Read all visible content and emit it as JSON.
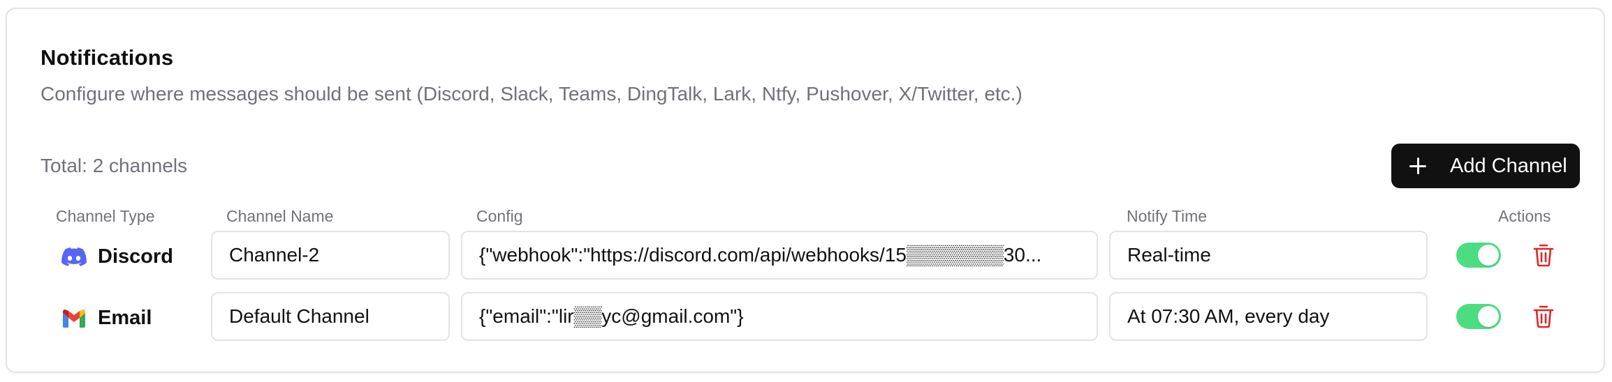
{
  "section": {
    "title": "Notifications",
    "description": "Configure where messages should be sent (Discord, Slack, Teams, DingTalk, Lark, Ntfy, Pushover, X/Twitter, etc.)",
    "total_label": "Total: 2 channels",
    "add_button_label": "Add Channel"
  },
  "table": {
    "headers": {
      "type": "Channel Type",
      "name": "Channel Name",
      "config": "Config",
      "notify_time": "Notify Time",
      "actions": "Actions"
    },
    "rows": [
      {
        "type": "Discord",
        "type_icon": "discord-icon",
        "name": "Channel-2",
        "config": "{\"webhook\":\"https://discord.com/api/webhooks/15▒▒▒▒▒▒▒30...",
        "notify_time": "Real-time",
        "enabled": true
      },
      {
        "type": "Email",
        "type_icon": "gmail-icon",
        "name": "Default Channel",
        "config": "{\"email\":\"lir▒▒yc@gmail.com\"}",
        "notify_time": "At 07:30 AM, every day",
        "enabled": true
      }
    ]
  },
  "colors": {
    "toggle_on": "#4ade80",
    "delete": "#dc2626",
    "discord": "#5865f2",
    "primary_button": "#111111"
  }
}
